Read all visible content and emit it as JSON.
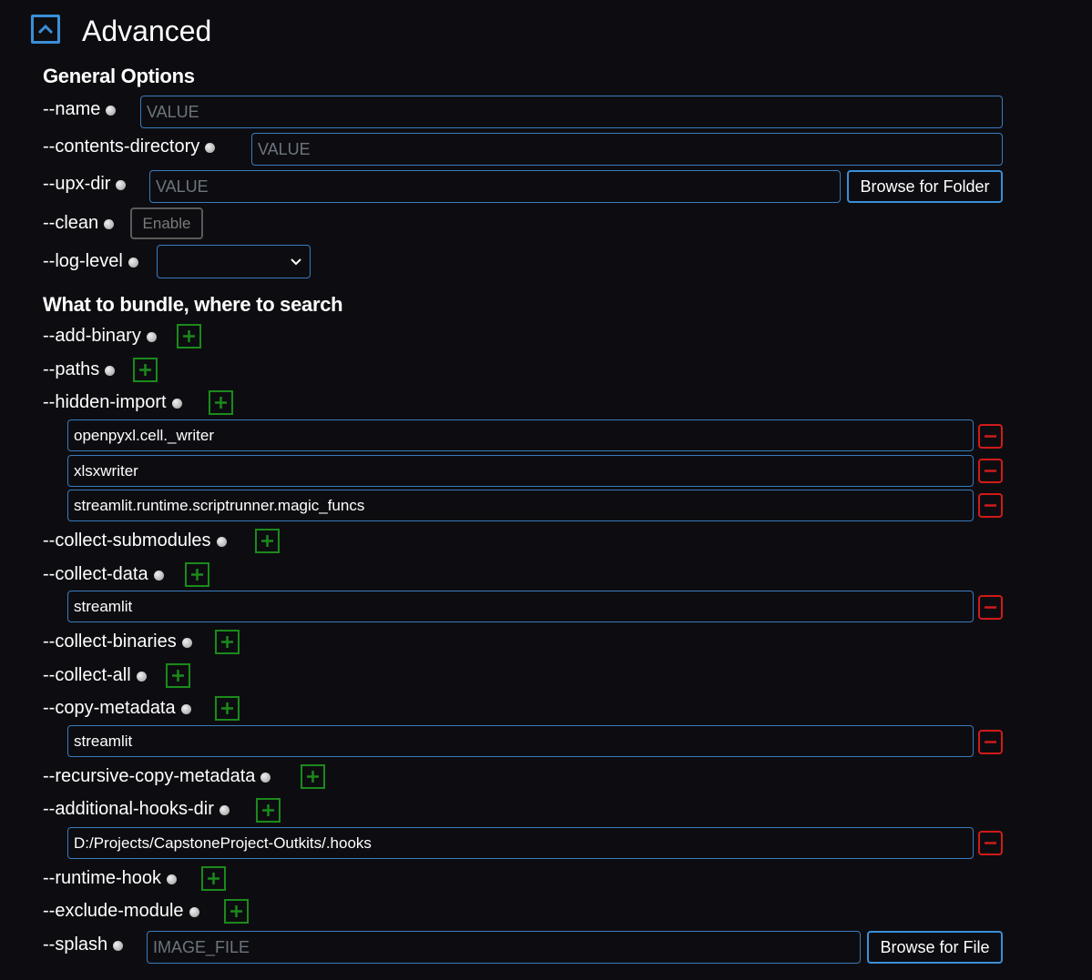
{
  "header": {
    "title": "Advanced"
  },
  "general": {
    "title": "General Options",
    "name": {
      "label": "--name",
      "placeholder": "VALUE"
    },
    "contents_directory": {
      "label": "--contents-directory",
      "placeholder": "VALUE"
    },
    "upx_dir": {
      "label": "--upx-dir",
      "placeholder": "VALUE",
      "browse_label": "Browse for Folder"
    },
    "clean": {
      "label": "--clean",
      "button_label": "Enable"
    },
    "log_level": {
      "label": "--log-level",
      "value": ""
    }
  },
  "bundle": {
    "title": "What to bundle, where to search",
    "add_binary": {
      "label": "--add-binary"
    },
    "paths": {
      "label": "--paths"
    },
    "hidden_import": {
      "label": "--hidden-import",
      "values": [
        "openpyxl.cell._writer",
        "xlsxwriter",
        "streamlit.runtime.scriptrunner.magic_funcs"
      ]
    },
    "collect_submodules": {
      "label": "--collect-submodules"
    },
    "collect_data": {
      "label": "--collect-data",
      "values": [
        "streamlit"
      ]
    },
    "collect_binaries": {
      "label": "--collect-binaries"
    },
    "collect_all": {
      "label": "--collect-all"
    },
    "copy_metadata": {
      "label": "--copy-metadata",
      "values": [
        "streamlit"
      ]
    },
    "recursive_copy_metadata": {
      "label": "--recursive-copy-metadata"
    },
    "additional_hooks_dir": {
      "label": "--additional-hooks-dir",
      "values": [
        "D:/Projects/CapstoneProject-Outkits/.hooks"
      ]
    },
    "runtime_hook": {
      "label": "--runtime-hook"
    },
    "exclude_module": {
      "label": "--exclude-module"
    },
    "splash": {
      "label": "--splash",
      "placeholder": "IMAGE_FILE",
      "browse_label": "Browse for File"
    }
  },
  "colors": {
    "accent": "#3a8fd8",
    "add": "#1b8a1b",
    "remove": "#d11a1a",
    "background": "#0d0d11"
  }
}
